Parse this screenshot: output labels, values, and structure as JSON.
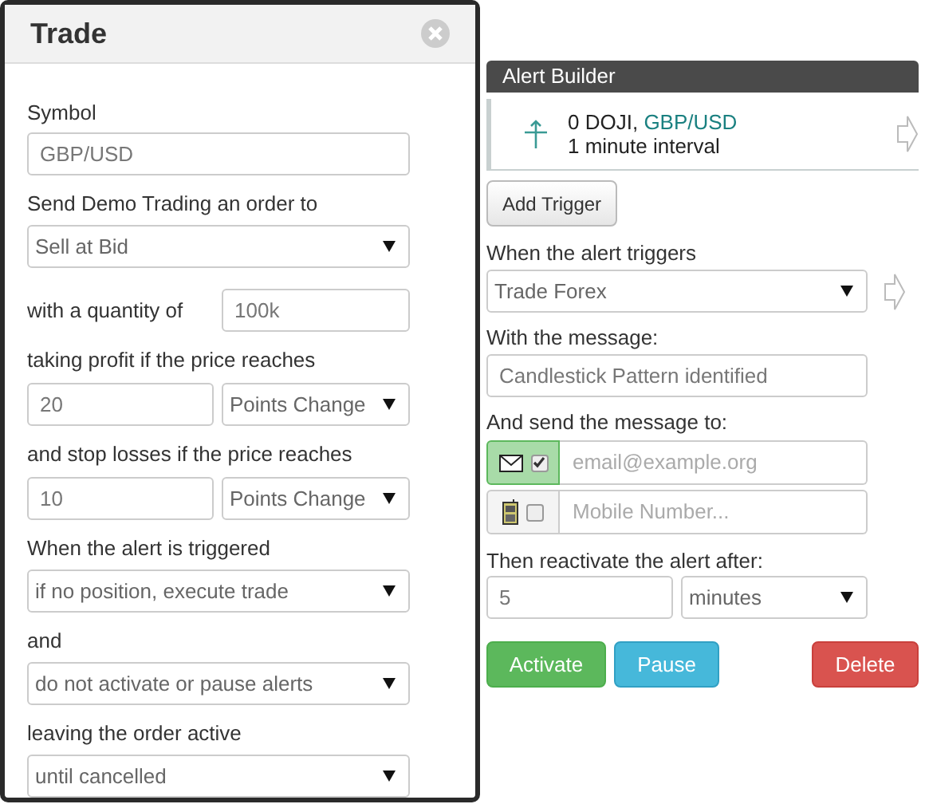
{
  "trade_dialog": {
    "title": "Trade",
    "fields": [
      {
        "kind": "input",
        "label": "Symbol",
        "value": "GBP/USD"
      },
      {
        "kind": "select",
        "label": "Send Demo Trading an order to",
        "value": "Sell at Bid"
      },
      {
        "kind": "inline",
        "label": "with a quantity of",
        "value": "100k"
      },
      {
        "kind": "pair",
        "label": "taking profit if the price reaches",
        "value": "20",
        "unit": "Points Change"
      },
      {
        "kind": "pair",
        "label": "and stop losses if the price reaches",
        "value": "10",
        "unit": "Points Change"
      },
      {
        "kind": "select",
        "label": "When the alert is triggered",
        "value": "if no position, execute trade"
      },
      {
        "kind": "select",
        "label": "and",
        "value": "do not activate or pause alerts"
      },
      {
        "kind": "select",
        "label": "leaving the order active",
        "value": "until cancelled"
      }
    ]
  },
  "alert_builder": {
    "title": "Alert Builder",
    "trigger": {
      "line1": "0 DOJI, ",
      "symbol": "GBP/USD",
      "line2": "1 minute interval"
    },
    "add_trigger": "Add Trigger",
    "action_label": "When the alert triggers",
    "action": "Trade Forex",
    "message_label": "With the message:",
    "message": "Candlestick Pattern identified",
    "send_label": "And send the message to:",
    "channels": [
      {
        "kind": "email",
        "checked": true,
        "placeholder": "email@example.org"
      },
      {
        "kind": "mobile",
        "checked": false,
        "placeholder": "Mobile Number..."
      }
    ],
    "reactivate_label": "Then reactivate the alert after:",
    "reactivate_value": "5",
    "reactivate_unit": "minutes",
    "buttons": [
      {
        "kind": "success",
        "label": "Activate"
      },
      {
        "kind": "info",
        "label": "Pause"
      },
      {
        "kind": "danger",
        "label": "Delete"
      }
    ]
  }
}
